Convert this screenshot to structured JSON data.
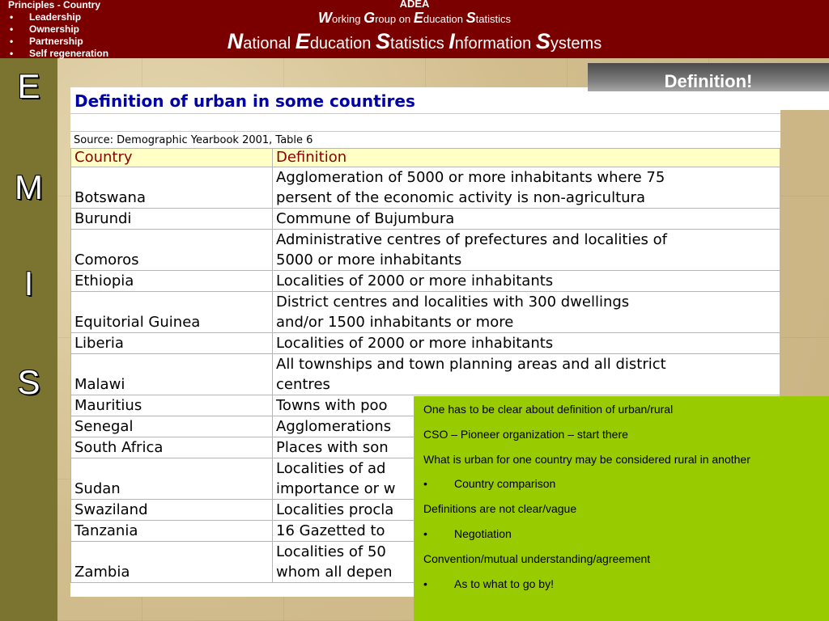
{
  "header": {
    "principles_title": "Principles - Country",
    "principles_items": [
      "Leadership",
      "Ownership",
      "Partnership",
      "Self regeneration"
    ],
    "org": "ADEA",
    "title1": [
      {
        "cap": "W",
        "rest": "orking"
      },
      {
        "cap": "G",
        "rest": "roup"
      },
      {
        "cap": "",
        "rest": "on"
      },
      {
        "cap": "E",
        "rest": "ducation"
      },
      {
        "cap": "S",
        "rest": "tatistics"
      }
    ],
    "title2": [
      {
        "cap": "N",
        "rest": "ational"
      },
      {
        "cap": "E",
        "rest": "ducation"
      },
      {
        "cap": "S",
        "rest": "tatistics"
      },
      {
        "cap": "I",
        "rest": "nformation"
      },
      {
        "cap": "S",
        "rest": "ystems"
      }
    ]
  },
  "sidebar": {
    "letters": [
      "E",
      "M",
      "I",
      "S"
    ]
  },
  "banner": {
    "label": "Definition!"
  },
  "panel": {
    "title": "Definition of urban in some countires",
    "source": "Source: Demographic Yearbook 2001, Table 6",
    "headers": [
      "Country",
      "Definition"
    ],
    "rows": [
      {
        "country": "Botswana",
        "definition": [
          "Agglomeration of 5000 or more inhabitants where 75",
          "persent of the economic activity is non-agricultura"
        ]
      },
      {
        "country": "Burundi",
        "definition": [
          "Commune of Bujumbura"
        ]
      },
      {
        "country": "Comoros",
        "definition": [
          "Administrative centres of prefectures and localities of",
          "5000 or more inhabitants"
        ]
      },
      {
        "country": "Ethiopia",
        "definition": [
          "Localities of 2000 or more inhabitants"
        ]
      },
      {
        "country": "Equitorial Guinea",
        "definition": [
          "District centres and localities with 300 dwellings",
          "and/or 1500 inhabitants or more"
        ]
      },
      {
        "country": "Liberia",
        "definition": [
          "Localities of 2000 or more inhabitants"
        ]
      },
      {
        "country": "Malawi",
        "definition": [
          "All townships and town planning areas and all district",
          "centres"
        ]
      },
      {
        "country": "Mauritius",
        "definition": [
          "Towns with poo"
        ]
      },
      {
        "country": "Senegal",
        "definition": [
          "Agglomerations"
        ]
      },
      {
        "country": "South Africa",
        "definition": [
          "Places with son"
        ]
      },
      {
        "country": "Sudan",
        "definition": [
          "Localities of ad",
          "importance or w"
        ]
      },
      {
        "country": "Swaziland",
        "definition": [
          "Localities procla"
        ]
      },
      {
        "country": "Tanzania",
        "definition": [
          "16 Gazetted to"
        ]
      },
      {
        "country": "Zambia",
        "definition": [
          "Localities of 50",
          "whom all depen"
        ]
      }
    ]
  },
  "notes": [
    {
      "bullet": false,
      "text": "One has to be clear about definition of urban/rural"
    },
    {
      "bullet": false,
      "text": "CSO – Pioneer organization – start there"
    },
    {
      "bullet": false,
      "text": "What is urban for one country may be considered rural in another"
    },
    {
      "bullet": true,
      "text": "Country comparison"
    },
    {
      "bullet": false,
      "text": "Definitions are not clear/vague"
    },
    {
      "bullet": true,
      "text": "Negotiation"
    },
    {
      "bullet": false,
      "text": "Convention/mutual understanding/agreement"
    },
    {
      "bullet": true,
      "text": "As to what to go by!"
    }
  ],
  "colors": {
    "header_bg": "#7a0000",
    "sidebar_bg": "#7a7430",
    "notes_bg": "#99cc00",
    "table_header_bg": "#ffffc6",
    "table_title": "#0000a8",
    "table_header_text": "#8b0000"
  }
}
